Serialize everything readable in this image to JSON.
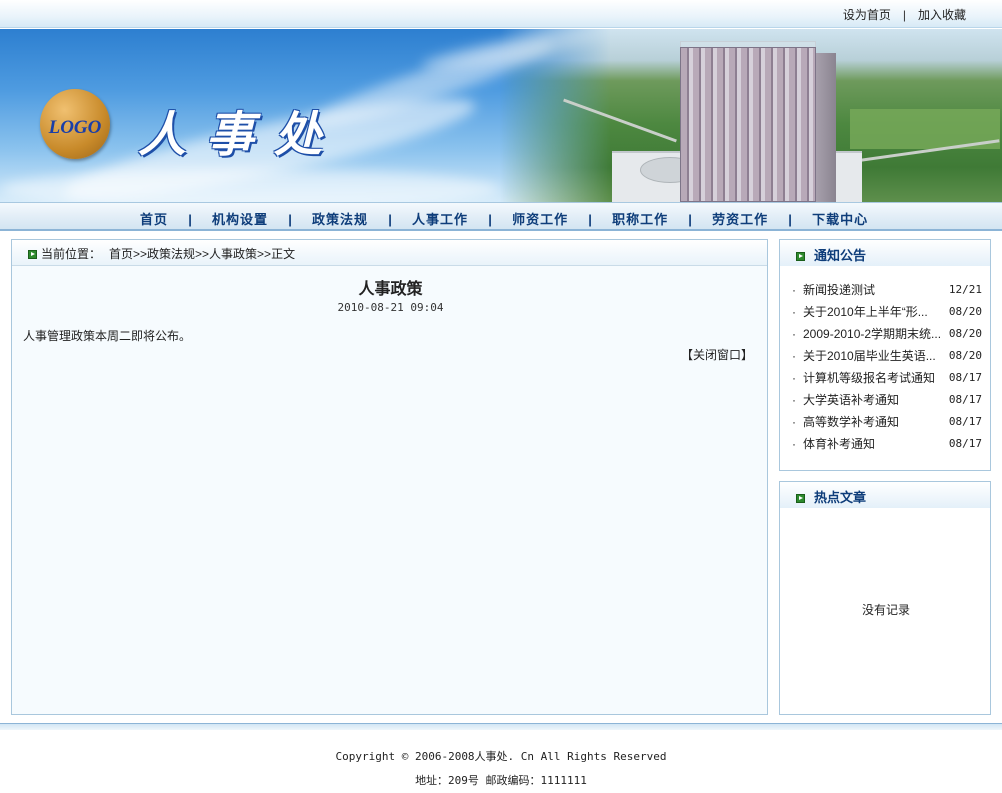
{
  "top_links": {
    "set_home": "设为首页",
    "separator": "|",
    "add_favorite": "加入收藏"
  },
  "banner": {
    "logo_text": "LOGO",
    "site_title": "人事处"
  },
  "nav": {
    "items": [
      "首页",
      "机构设置",
      "政策法规",
      "人事工作",
      "师资工作",
      "职称工作",
      "劳资工作",
      "下载中心"
    ],
    "separator": "|"
  },
  "breadcrumb": {
    "label": "当前位置：",
    "path": "首页>>政策法规>>人事政策>>正文"
  },
  "article": {
    "title": "人事政策",
    "date": "2010-08-21 09:04",
    "body": "人事管理政策本周二即将公布。",
    "close_label": "【关闭窗口】"
  },
  "notice": {
    "heading": "通知公告",
    "bullet": "·",
    "items": [
      {
        "title": "新闻投递测试",
        "date": "12/21"
      },
      {
        "title": "关于2010年上半年“形...",
        "date": "08/20"
      },
      {
        "title": "2009-2010-2学期期末统...",
        "date": "08/20"
      },
      {
        "title": "关于2010届毕业生英语...",
        "date": "08/20"
      },
      {
        "title": "计算机等级报名考试通知",
        "date": "08/17"
      },
      {
        "title": "大学英语补考通知",
        "date": "08/17"
      },
      {
        "title": "高等数学补考通知",
        "date": "08/17"
      },
      {
        "title": "体育补考通知",
        "date": "08/17"
      }
    ]
  },
  "hot": {
    "heading": "热点文章",
    "empty_text": "没有记录"
  },
  "footer": {
    "copyright": "Copyright © 2006-2008人事处. Cn All Rights Reserved",
    "address": "地址：209号 邮政编码：1111111"
  },
  "colors": {
    "nav_text": "#0e3d7a",
    "border": "#a9c7dd",
    "bullet_green": "#2d8a2d"
  }
}
